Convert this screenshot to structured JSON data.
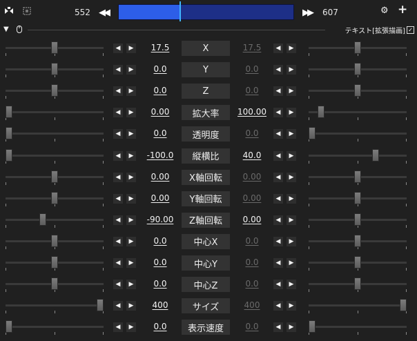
{
  "toolbar": {
    "camera_icon": "camera-icon",
    "frame_icon": "frame-select-icon",
    "start_frame": "552",
    "end_frame": "607",
    "prev_symbol": "◀◀",
    "next_symbol": "▶▶",
    "settings_symbol": "⚙",
    "add_symbol": "+",
    "timeline_progress": 0.35
  },
  "header_row": {
    "collapse_symbol": "▼",
    "mouse_symbol": "🖱",
    "extended_draw_label": "テキスト[拡張描画]",
    "extended_draw_checked": "✓"
  },
  "arrows": {
    "left": "◀",
    "right": "▶"
  },
  "params": [
    {
      "label": "X",
      "left": "17.5",
      "right": "17.5",
      "right_active": false,
      "left_slider": 0.5,
      "right_slider": 0.5
    },
    {
      "label": "Y",
      "left": "0.0",
      "right": "0.0",
      "right_active": false,
      "left_slider": 0.5,
      "right_slider": 0.5
    },
    {
      "label": "Z",
      "left": "0.0",
      "right": "0.0",
      "right_active": false,
      "left_slider": 0.5,
      "right_slider": 0.5
    },
    {
      "label": "拡大率",
      "left": "0.00",
      "right": "100.00",
      "right_active": true,
      "left_slider": 0.0,
      "right_slider": 0.1
    },
    {
      "label": "透明度",
      "left": "0.0",
      "right": "0.0",
      "right_active": false,
      "left_slider": 0.0,
      "right_slider": 0.0
    },
    {
      "label": "縦横比",
      "left": "-100.0",
      "right": "40.0",
      "right_active": true,
      "left_slider": 0.0,
      "right_slider": 0.7
    },
    {
      "label": "X軸回転",
      "left": "0.00",
      "right": "0.00",
      "right_active": false,
      "left_slider": 0.5,
      "right_slider": 0.5
    },
    {
      "label": "Y軸回転",
      "left": "0.00",
      "right": "0.00",
      "right_active": false,
      "left_slider": 0.5,
      "right_slider": 0.5
    },
    {
      "label": "Z軸回転",
      "left": "-90.00",
      "right": "0.00",
      "right_active": true,
      "left_slider": 0.37,
      "right_slider": 0.5
    },
    {
      "label": "中心X",
      "left": "0.0",
      "right": "0.0",
      "right_active": false,
      "left_slider": 0.5,
      "right_slider": 0.5
    },
    {
      "label": "中心Y",
      "left": "0.0",
      "right": "0.0",
      "right_active": false,
      "left_slider": 0.5,
      "right_slider": 0.5
    },
    {
      "label": "中心Z",
      "left": "0.0",
      "right": "0.0",
      "right_active": false,
      "left_slider": 0.5,
      "right_slider": 0.5
    },
    {
      "label": "サイズ",
      "left": "400",
      "right": "400",
      "right_active": false,
      "left_slider": 1.0,
      "right_slider": 1.0
    },
    {
      "label": "表示速度",
      "left": "0.0",
      "right": "0.0",
      "right_active": false,
      "left_slider": 0.0,
      "right_slider": 0.0
    }
  ]
}
